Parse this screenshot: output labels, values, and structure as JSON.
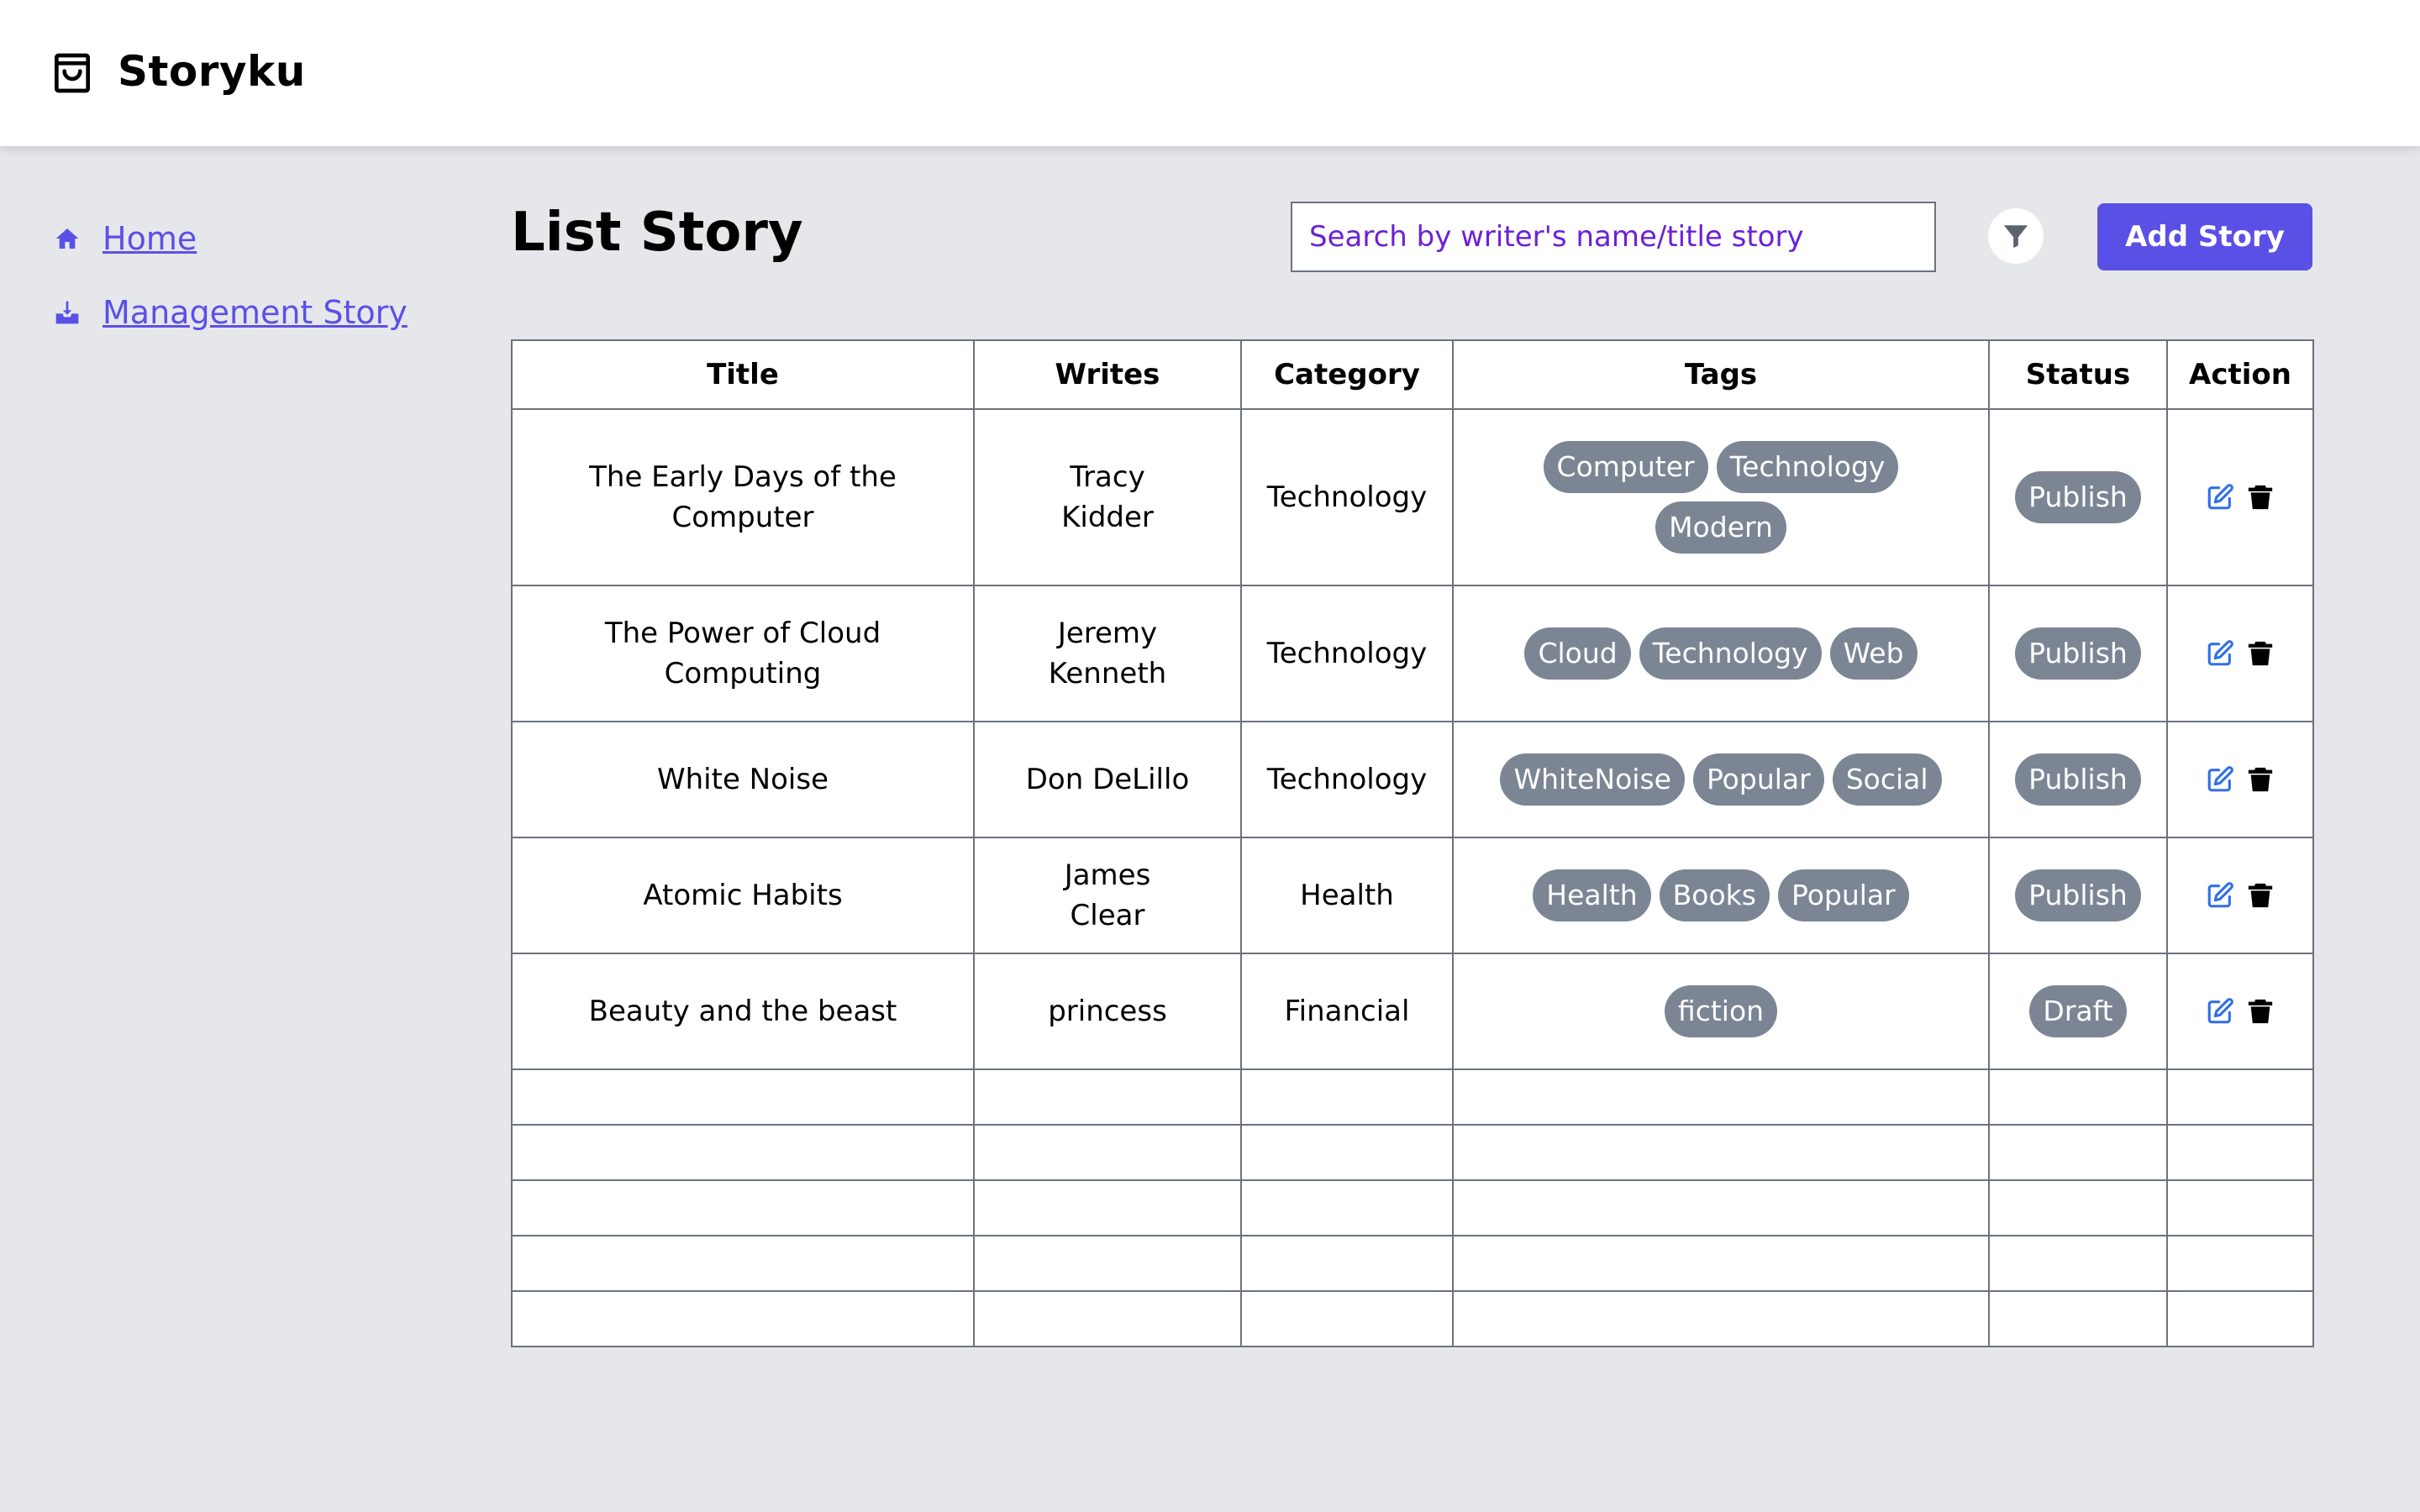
{
  "app": {
    "name": "Storyku"
  },
  "sidebar": {
    "items": [
      {
        "label": "Home",
        "icon": "home-icon"
      },
      {
        "label": "Management Story",
        "icon": "inbox-download-icon"
      }
    ]
  },
  "page": {
    "title": "List Story",
    "search_placeholder": "Search by writer's name/title story",
    "add_label": "Add Story"
  },
  "table": {
    "columns": [
      "Title",
      "Writes",
      "Category",
      "Tags",
      "Status",
      "Action"
    ],
    "rows": [
      {
        "title": "The Early Days of the Computer",
        "writer": "Tracy Kidder",
        "category": "Technology",
        "tags": [
          "Computer",
          "Technology",
          "Modern"
        ],
        "status": "Publish"
      },
      {
        "title": "The Power of Cloud Computing",
        "writer": "Jeremy Kenneth",
        "category": "Technology",
        "tags": [
          "Cloud",
          "Technology",
          "Web"
        ],
        "status": "Publish"
      },
      {
        "title": "White Noise",
        "writer": "Don DeLillo",
        "category": "Technology",
        "tags": [
          "WhiteNoise",
          "Popular",
          "Social"
        ],
        "status": "Publish"
      },
      {
        "title": "Atomic Habits",
        "writer": "James Clear",
        "category": "Health",
        "tags": [
          "Health",
          "Books",
          "Popular"
        ],
        "status": "Publish"
      },
      {
        "title": "Beauty and the beast",
        "writer": "princess",
        "category": "Financial",
        "tags": [
          "fiction"
        ],
        "status": "Draft"
      }
    ],
    "empty_rows": 5
  },
  "colors": {
    "accent": "#5b50e6",
    "pill": "#7b8594",
    "edit_icon": "#2f6fe8",
    "background": "#e5e7eb"
  }
}
